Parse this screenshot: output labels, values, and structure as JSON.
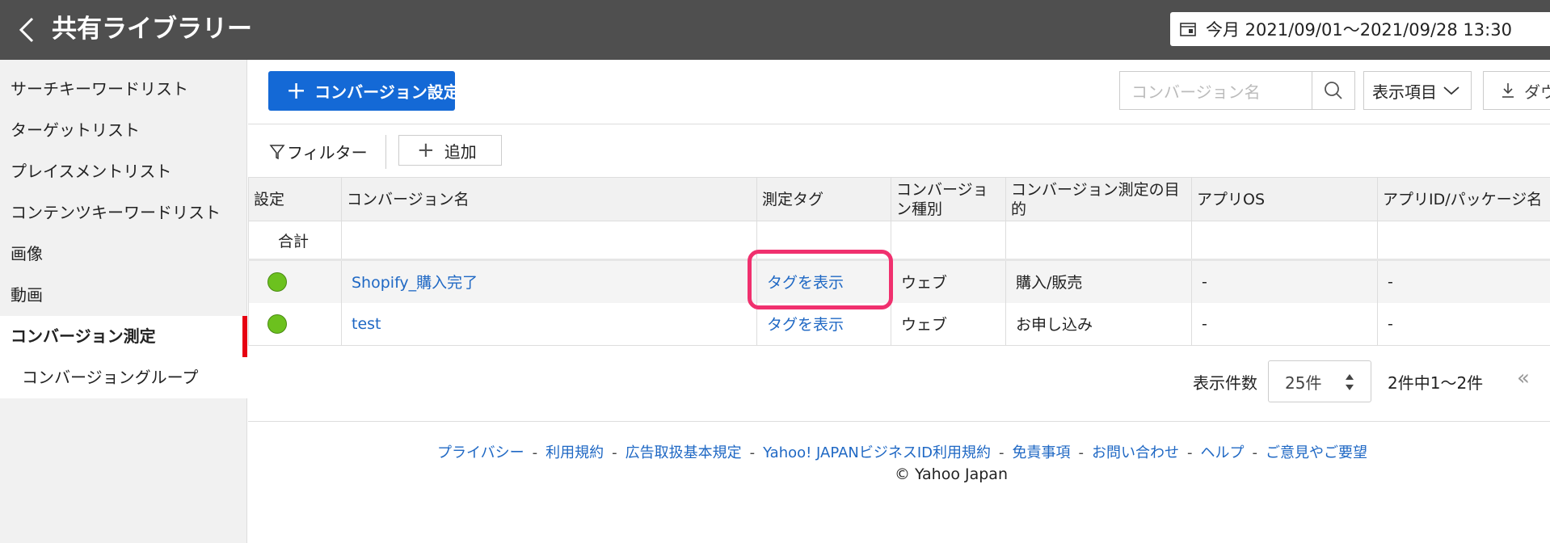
{
  "header": {
    "title": "共有ライブラリー",
    "date_range": "今月 2021/09/01〜2021/09/28 13:30"
  },
  "sidebar": {
    "items": [
      {
        "label": "サーチキーワードリスト"
      },
      {
        "label": "ターゲットリスト"
      },
      {
        "label": "プレイスメントリスト"
      },
      {
        "label": "コンテンツキーワードリスト"
      },
      {
        "label": "画像"
      },
      {
        "label": "動画"
      },
      {
        "label": "コンバージョン測定"
      },
      {
        "label": "コンバージョングループ"
      }
    ],
    "active_index": 6
  },
  "toolbar": {
    "create_label": "コンバージョン設定を作成",
    "search_placeholder": "コンバージョン名",
    "columns_label": "表示項目",
    "download_label": "ダウ"
  },
  "filterbar": {
    "filter_label": "フィルター",
    "add_label": "追加"
  },
  "table": {
    "headers": [
      "設定",
      "コンバージョン名",
      "測定タグ",
      "コンバージョン種別",
      "コンバージョン測定の目的",
      "アプリOS",
      "アプリID/パッケージ名"
    ],
    "total_label": "合計",
    "rows": [
      {
        "status": "active",
        "name": "Shopify_購入完了",
        "tag": "タグを表示",
        "type": "ウェブ",
        "purpose": "購入/販売",
        "os": "-",
        "app_id": "-"
      },
      {
        "status": "active",
        "name": "test",
        "tag": "タグを表示",
        "type": "ウェブ",
        "purpose": "お申し込み",
        "os": "-",
        "app_id": "-"
      }
    ]
  },
  "pager": {
    "per_page_label": "表示件数",
    "per_page_value": "25件",
    "count": "2件中1〜2件"
  },
  "footer": {
    "links": [
      "プライバシー",
      "利用規約",
      "広告取扱基本規定",
      "Yahoo! JAPANビジネスID利用規約",
      "免責事項",
      "お問い合わせ",
      "ヘルプ",
      "ご意見やご要望"
    ],
    "separator": "-",
    "copyright": "© Yahoo Japan"
  },
  "colors": {
    "header_bg": "#4f4f4f",
    "primary_button": "#1469d6",
    "link": "#1f68c4",
    "active_marker": "#e60012",
    "status_active": "#6cc11e",
    "highlight": "#f0306e"
  }
}
